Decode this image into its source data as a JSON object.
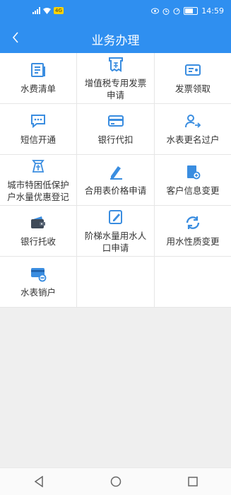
{
  "status_bar": {
    "time": "14:59",
    "network_badge": "4G"
  },
  "header": {
    "title": "业务办理"
  },
  "services": [
    {
      "label": "水费清单",
      "icon": "bill-list-icon"
    },
    {
      "label": "增值税专用发票申请",
      "icon": "invoice-icon"
    },
    {
      "label": "发票领取",
      "icon": "receipt-card-icon"
    },
    {
      "label": "短信开通",
      "icon": "sms-icon"
    },
    {
      "label": "银行代扣",
      "icon": "bank-card-icon"
    },
    {
      "label": "水表更名过户",
      "icon": "user-transfer-icon"
    },
    {
      "label": "城市特困低保护户水量优惠登记",
      "icon": "subsidy-icon"
    },
    {
      "label": "合用表价格申请",
      "icon": "edit-icon"
    },
    {
      "label": "客户信息变更",
      "icon": "info-change-icon"
    },
    {
      "label": "银行托收",
      "icon": "wallet-icon"
    },
    {
      "label": "阶梯水量用水人口申请",
      "icon": "note-edit-icon"
    },
    {
      "label": "用水性质变更",
      "icon": "refresh-icon"
    },
    {
      "label": "水表销户",
      "icon": "card-remove-icon"
    }
  ],
  "colors": {
    "primary": "#2f8ff0",
    "icon": "#3a8de0"
  }
}
